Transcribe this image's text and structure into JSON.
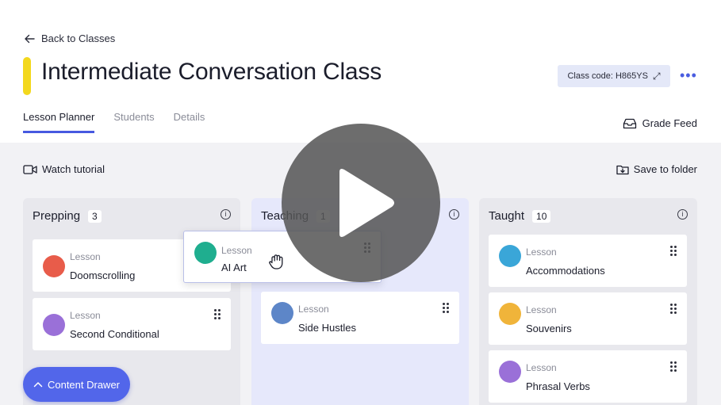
{
  "nav": {
    "back_label": "Back to Classes"
  },
  "header": {
    "title": "Intermediate Conversation Class",
    "accent_color": "#f3d81d",
    "class_code": "Class code: H865YS",
    "more_label": "•••"
  },
  "tabs": [
    {
      "label": "Lesson Planner",
      "active": true
    },
    {
      "label": "Students",
      "active": false
    },
    {
      "label": "Details",
      "active": false
    }
  ],
  "toolbar": {
    "grade_feed": "Grade Feed",
    "watch_tutorial": "Watch tutorial",
    "save_to_folder": "Save to folder"
  },
  "columns": [
    {
      "title": "Prepping",
      "count": "3",
      "cards": [
        {
          "kind": "Lesson",
          "name": "Doomscrolling",
          "icon": "phone-scroll-icon",
          "color": "#e85c4a"
        },
        {
          "kind": "Lesson",
          "name": "Second Conditional",
          "icon": "document-icon",
          "color": "#9a70d8"
        }
      ]
    },
    {
      "title": "Teaching",
      "count": "1",
      "cards": [
        {
          "kind": "Lesson",
          "name": "Side Hustles",
          "icon": "people-icon",
          "color": "#5d86c8"
        }
      ]
    },
    {
      "title": "Taught",
      "count": "10",
      "cards": [
        {
          "kind": "Lesson",
          "name": "Accommodations",
          "icon": "hotel-icon",
          "color": "#3aa6d8"
        },
        {
          "kind": "Lesson",
          "name": "Souvenirs",
          "icon": "souvenir-icon",
          "color": "#f0b43a"
        },
        {
          "kind": "Lesson",
          "name": "Phrasal Verbs",
          "icon": "document-icon",
          "color": "#9a70d8"
        }
      ]
    }
  ],
  "dragging_card": {
    "kind": "Lesson",
    "name": "AI Art",
    "icon": "robot-icon",
    "color": "#1fae8f"
  },
  "content_drawer": {
    "label": "Content Drawer",
    "icon": "chevron-up-icon"
  },
  "video_overlay": {
    "icon": "play-icon"
  }
}
